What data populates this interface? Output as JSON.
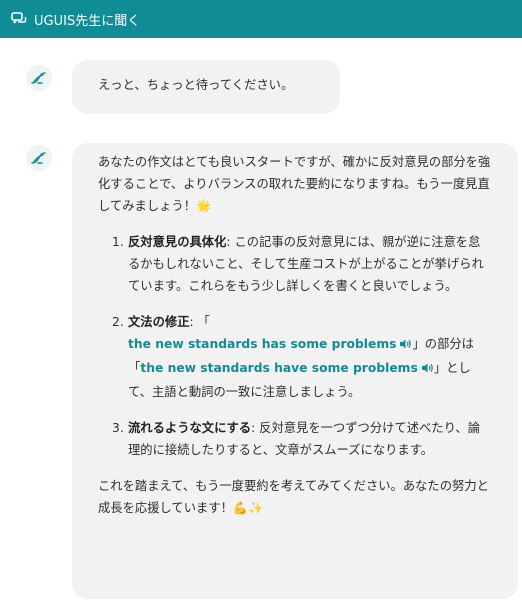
{
  "header": {
    "title": "UGUIS先生に聞く"
  },
  "messages": [
    {
      "text": "えっと、ちょっと待ってください。"
    },
    {
      "intro": "あなたの作文はとても良いスタートですが、確かに反対意見の部分を強化することで、よりバランスの取れた要約になりますね。もう一度見直してみましょう！🌟",
      "items": [
        {
          "num": "1.",
          "title": "反対意見の具体化",
          "body": ": この記事の反対意見には、親が逆に注意を怠るかもしれないこと、そして生産コストが上がることが挙げられています。これらをもう少し詳しくを書くと良いでしょう。"
        },
        {
          "num": "2.",
          "title": "文法の修正",
          "pre": ": 「",
          "wrong": "the new standards has some problems",
          "mid": "」の部分は「",
          "right": "the new standards have some problems",
          "post": "」として、主語と動詞の一致に注意しましょう。"
        },
        {
          "num": "3.",
          "title": "流れるような文にする",
          "body": ": 反対意見を一つずつ分けて述べたり、論理的に接続したりすると、文章がスムーズになります。"
        }
      ],
      "outro": "これを踏まえて、もう一度要約を考えてみてください。あなたの努力と成長を応援しています！💪✨"
    }
  ],
  "colors": {
    "header": "#0f8c95",
    "bubble": "#f2f2f2",
    "link": "#0f8c95"
  }
}
